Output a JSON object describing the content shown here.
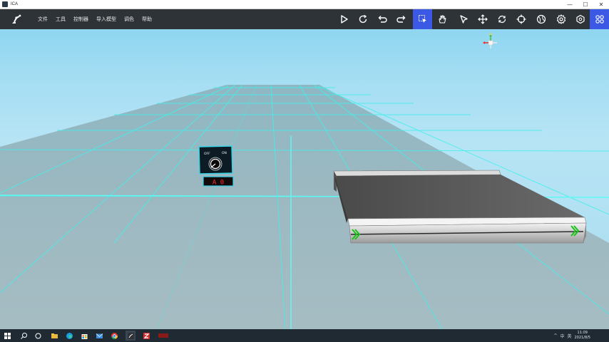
{
  "window": {
    "title": "ICA",
    "controls": [
      "—",
      "☐",
      "✕"
    ]
  },
  "menu": [
    "文件",
    "工具",
    "控制器",
    "导入模型",
    "调色",
    "帮助"
  ],
  "toolbar": {
    "icons": [
      "play-icon",
      "refresh-icon",
      "undo-icon",
      "redo-icon",
      "select-box-icon",
      "hand-icon",
      "pointer-icon",
      "move-icon",
      "rotate-icon",
      "target-icon",
      "globe-icon",
      "gear-icon",
      "hexagon-icon",
      "grid-apps-icon"
    ],
    "active": [
      "select-box-icon",
      "grid-apps-icon"
    ]
  },
  "scene": {
    "panel": {
      "left_label": "OFF",
      "right_label": "ON",
      "display": "A 0"
    },
    "colors": {
      "grid": "#42f0ea",
      "sky": "#8fd6f0",
      "ground": "#9fb4bc",
      "display": "#ff2a2a"
    }
  },
  "taskbar": {
    "apps": [
      "start-icon",
      "search-icon",
      "task-view-icon",
      "edge-icon",
      "store-icon",
      "mail-icon",
      "photos-icon",
      "chrome-icon",
      "explorer-icon",
      "ica-app-icon",
      "filezilla-icon"
    ],
    "tray": [
      "^",
      "中",
      "英"
    ],
    "time": "11:09",
    "date": "2021/8/5"
  }
}
